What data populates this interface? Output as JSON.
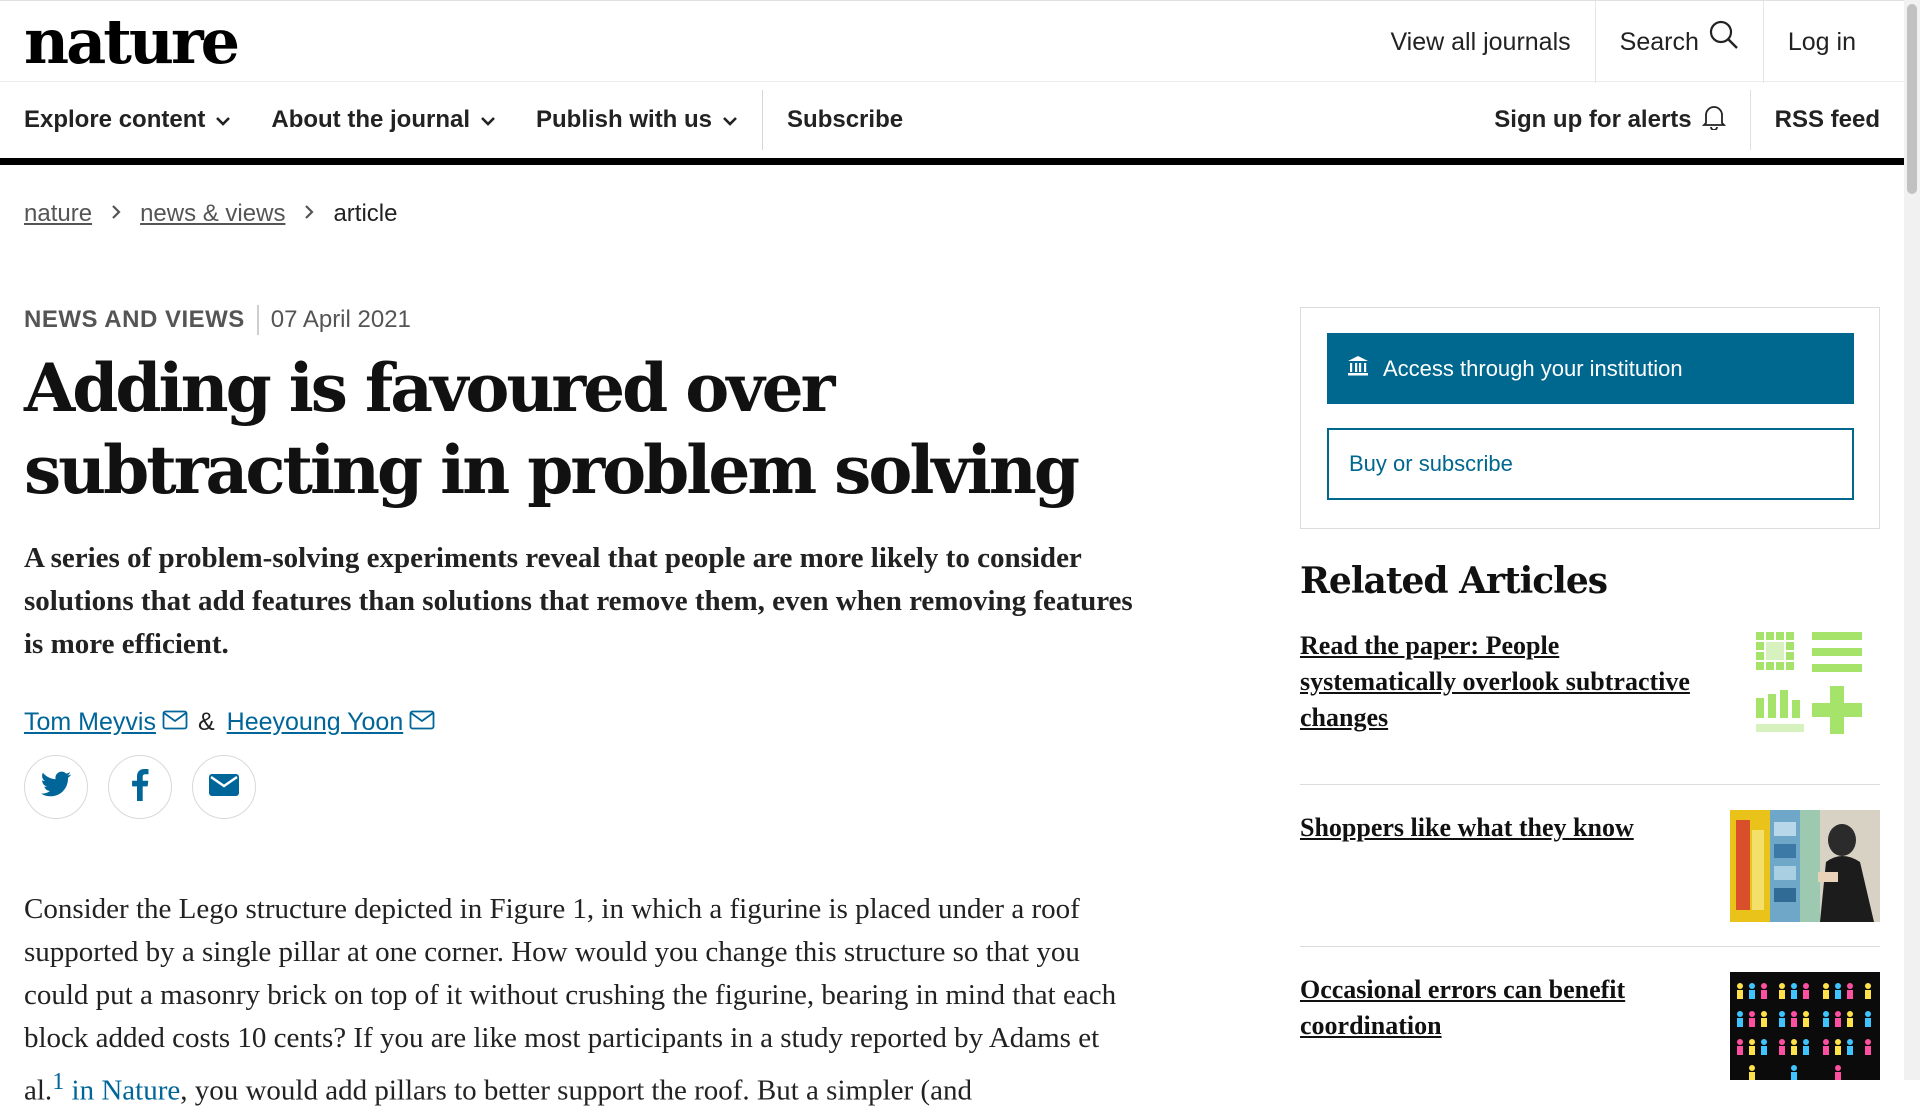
{
  "header": {
    "logo": "nature",
    "links": {
      "view_all": "View all journals",
      "search": "Search",
      "login": "Log in"
    }
  },
  "nav": {
    "explore": "Explore content",
    "about": "About the journal",
    "publish": "Publish with us",
    "subscribe": "Subscribe",
    "alerts": "Sign up for alerts",
    "rss": "RSS feed"
  },
  "breadcrumb": {
    "home": "nature",
    "section": "news & views",
    "current": "article"
  },
  "article": {
    "type": "NEWS AND VIEWS",
    "date": "07 April 2021",
    "title": "Adding is favoured over subtracting in problem solving",
    "standfirst": "A series of problem-solving experiments reveal that people are more likely to consider solutions that add features than solutions that remove them, even when removing features is more efficient.",
    "authors": [
      "Tom Meyvis",
      "Heeyoung Yoon"
    ],
    "author_joiner": "&",
    "body_p1": "Consider the Lego structure depicted in Figure 1, in which a figurine is placed under a roof supported by a single pillar at one corner. How would you change this structure so that you could put a masonry brick on top of it without crushing the figurine, bearing in mind that each block added costs 10 cents? If you are like most participants in a study reported by",
    "body_p1_tail_a": "Adams et al.",
    "body_p1_cite": "1",
    "body_p1_cite_journal": "in Nature",
    "body_p1_tail_b": ", you would add pillars to better support the roof. But a simpler (and"
  },
  "sidebar": {
    "access_label": "Access through your institution",
    "buy_label": "Buy or subscribe",
    "related_title": "Related Articles",
    "related": [
      {
        "title": "Read the paper: People systematically overlook subtractive changes"
      },
      {
        "title": "Shoppers like what they know"
      },
      {
        "title": "Occasional errors can benefit coordination"
      }
    ]
  },
  "colors": {
    "brand_blue": "#00678f",
    "link_blue": "#006699",
    "black_rule": "#000000"
  }
}
